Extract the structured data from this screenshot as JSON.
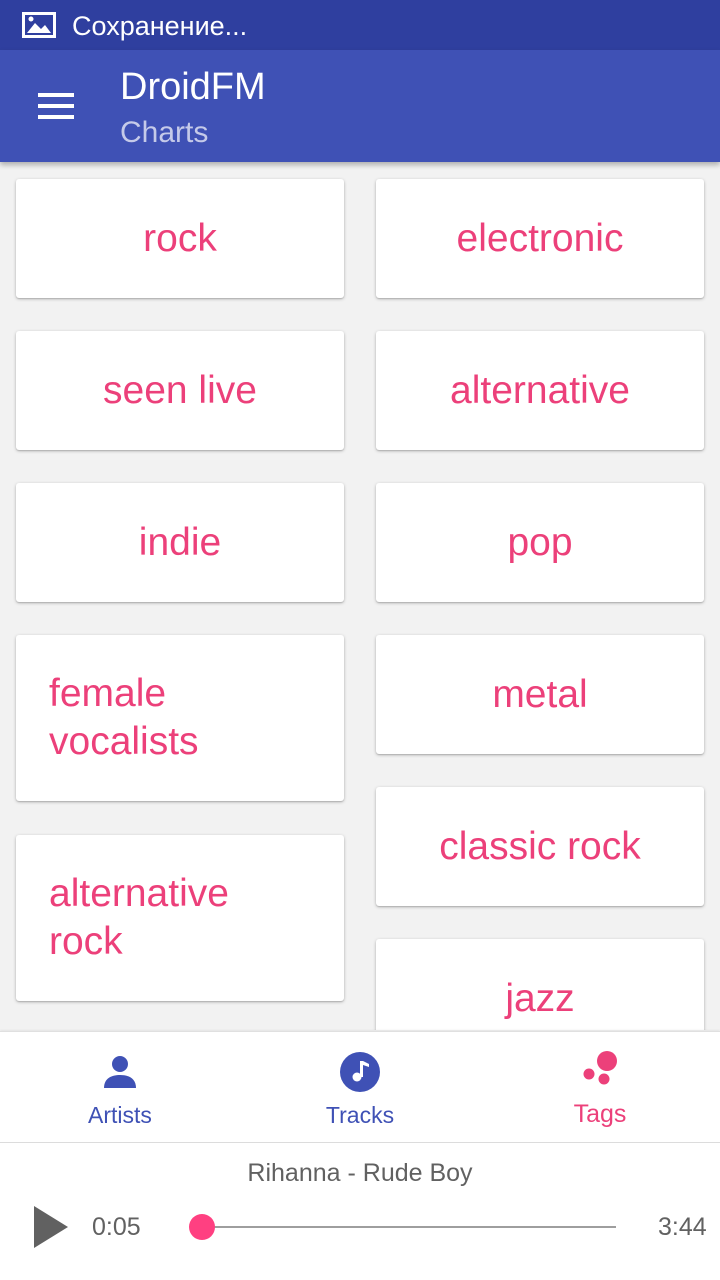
{
  "status_bar": {
    "icon": "image-icon",
    "text": "Сохранение..."
  },
  "app_bar": {
    "menu_icon": "hamburger-menu-icon",
    "title": "DroidFM",
    "subtitle": "Charts"
  },
  "tags": [
    {
      "label": "rock"
    },
    {
      "label": "electronic"
    },
    {
      "label": "seen live"
    },
    {
      "label": "alternative"
    },
    {
      "label": "indie"
    },
    {
      "label": "pop"
    },
    {
      "label": "female vocalists"
    },
    {
      "label": "metal"
    },
    {
      "label": "alternative rock"
    },
    {
      "label": "classic rock"
    },
    {
      "label": "jazz"
    }
  ],
  "bottom_nav": {
    "items": [
      {
        "label": "Artists",
        "icon": "person-icon",
        "active": false
      },
      {
        "label": "Tracks",
        "icon": "music-note-icon",
        "active": false
      },
      {
        "label": "Tags",
        "icon": "tags-bubbles-icon",
        "active": true
      }
    ],
    "colors": {
      "inactive": "#3f51b5",
      "active": "#ec407a"
    }
  },
  "player": {
    "track": "Rihanna - Rude Boy",
    "current_time": "0:05",
    "total_time": "3:44",
    "progress_fraction": 0.02,
    "play_icon": "play-icon"
  },
  "colors": {
    "primary": "#3f51b5",
    "primary_dark": "#2f3f9f",
    "accent": "#ec407a",
    "background": "#f2f2f2"
  }
}
